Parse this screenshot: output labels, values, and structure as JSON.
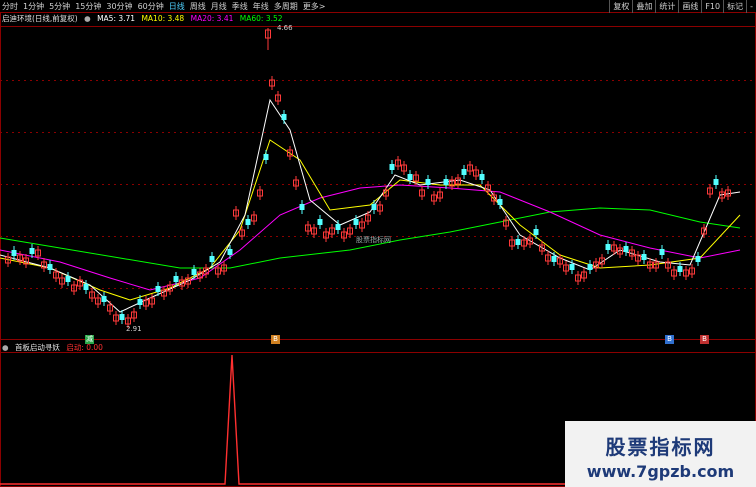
{
  "toolbar": {
    "periods": [
      "分时",
      "1分钟",
      "5分钟",
      "15分钟",
      "30分钟",
      "60分钟",
      "日线",
      "周线",
      "月线",
      "季线",
      "年线",
      "多周期",
      "更多>"
    ],
    "active_period": "日线",
    "actions": [
      "复权",
      "叠加",
      "统计",
      "画线",
      "F10",
      "标记",
      "-"
    ]
  },
  "main_pane": {
    "title": "启迪环境(日线,前复权)",
    "ma": [
      {
        "label": "MA5: 3.71",
        "color": "#ffffff"
      },
      {
        "label": "MA10: 3.48",
        "color": "#ffff00"
      },
      {
        "label": "MA20: 3.41",
        "color": "#ff00ff"
      },
      {
        "label": "MA60: 3.52",
        "color": "#00ff00"
      }
    ],
    "high_label": "4.66",
    "low_label": "2.91",
    "watermark_text": "股票指标网",
    "signals": [
      {
        "text": "减",
        "color": "#2aa84a"
      },
      {
        "text": "B",
        "color": "#d08020"
      },
      {
        "text": "B",
        "color": "#3070d0"
      },
      {
        "text": "B",
        "color": "#c03030"
      }
    ]
  },
  "indicator_pane": {
    "title": "首板启动寻妖",
    "value_label": "启动: 0.00",
    "value_color": "#ff3030"
  },
  "brand": {
    "line1": "股票指标网",
    "line2": "www.7gpzb.com"
  },
  "colors": {
    "up": "#ff3a3a",
    "down": "#54ffff",
    "ma5": "#ffffff",
    "ma10": "#ffff00",
    "ma20": "#ff00ff",
    "ma60": "#00ff00",
    "grid": "#8b0000"
  }
}
